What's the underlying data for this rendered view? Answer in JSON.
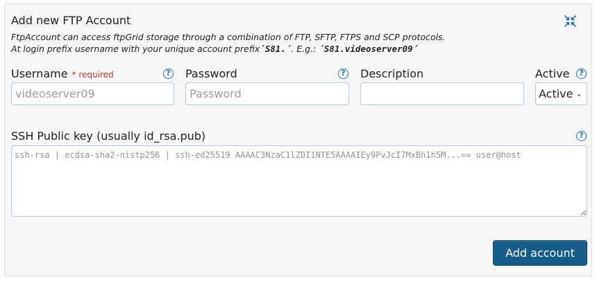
{
  "form": {
    "title": "Add new FTP Account",
    "description_line1": "FtpAccount can access ftpGrid storage through a combination of FTP, SFTP, FTPS and SCP protocols.",
    "description_line2_prefix": "At login prefix username with your unique account prefix",
    "description_line2_prefix_code": "´S81.´",
    "description_line2_eg": ". E.g.: ",
    "description_line2_example_code": "´S81.videoserver09´",
    "collapse_icon": "collapse-arrows-icon"
  },
  "fields": {
    "username": {
      "label": "Username",
      "required": "* required",
      "placeholder": "videoserver09",
      "value": ""
    },
    "password": {
      "label": "Password",
      "placeholder": "Password",
      "value": ""
    },
    "description": {
      "label": "Description",
      "placeholder": "",
      "value": ""
    },
    "active": {
      "label": "Active",
      "selected": "Active"
    },
    "ssh_key": {
      "label": "SSH Public key (usually id_rsa.pub)",
      "placeholder": "ssh-rsa | ecdsa-sha2-nistp256 | ssh-ed25519 AAAAC3NzaC1lZDI1NTE5AAAAIEy9PvJcI7MxBh1h5M...== user@host"
    }
  },
  "actions": {
    "submit_label": "Add account"
  },
  "colors": {
    "accent": "#1e73be",
    "button": "#155e8c",
    "required": "#c0392b",
    "panel_bg": "#f7f7f8"
  }
}
